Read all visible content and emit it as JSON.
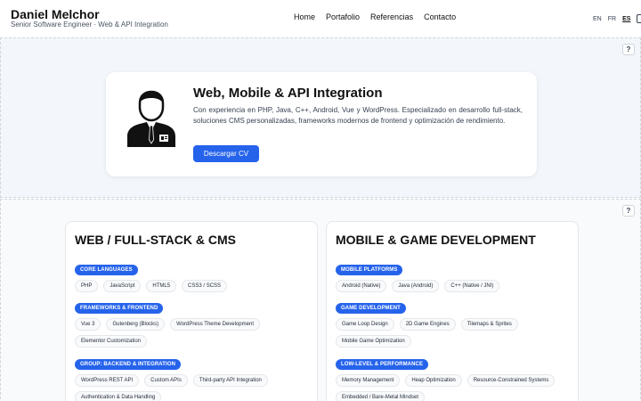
{
  "header": {
    "name": "Daniel Melchor",
    "subtitle": "Senior Software Engineer · Web & API Integration",
    "nav": [
      "Home",
      "Portafolio",
      "Referencias",
      "Contacto"
    ],
    "languages": [
      "EN",
      "FR",
      "ES"
    ],
    "active_language": "ES",
    "mode_icon": "theme-toggle-icon"
  },
  "help_label": "?",
  "hero": {
    "title": "Web, Mobile & API Integration",
    "description": "Con experiencia en PHP, Java, C++, Android, Vue y WordPress. Especializado en desarrollo full-stack, soluciones CMS personalizadas, frameworks modernos de frontend y optimización de rendimiento.",
    "cv_button": "Descargar CV",
    "avatar_icon": "businessman-avatar-icon"
  },
  "skills": {
    "web": {
      "title": "WEB / FULL-STACK & CMS",
      "groups": [
        {
          "label": "CORE LANGUAGES",
          "tags": [
            "PHP",
            "JavaScript",
            "HTML5",
            "CSS3 / SCSS"
          ]
        },
        {
          "label": "FRAMEWORKS & FRONTEND",
          "tags": [
            "Vue 3",
            "Gutenberg (Blocks)",
            "WordPress Theme Development",
            "Elementor Customization"
          ]
        },
        {
          "label": "GROUP: BACKEND & INTEGRATION",
          "tags": [
            "WordPress REST API",
            "Custom APIs",
            "Third-party API Integration",
            "Authentication & Data Handling"
          ]
        }
      ]
    },
    "mobile": {
      "title": "MOBILE & GAME DEVELOPMENT",
      "groups": [
        {
          "label": "MOBILE PLATFORMS",
          "tags": [
            "Android (Native)",
            "Java (Android)",
            "C++ (Native / JNI)"
          ]
        },
        {
          "label": "GAME DEVELOPMENT",
          "tags": [
            "Game Loop Design",
            "2D Game Engines",
            "Tilemaps & Sprites",
            "Mobile Game Optimization"
          ]
        },
        {
          "label": "LOW-LEVEL & PERFORMANCE",
          "tags": [
            "Memory Management",
            "Heap Optimization",
            "Resource-Constrained Systems",
            "Embedded / Bare-Metal Mindset"
          ]
        }
      ]
    }
  },
  "colors": {
    "accent": "#2563eb",
    "hero_bg": "#f3f6fa"
  }
}
